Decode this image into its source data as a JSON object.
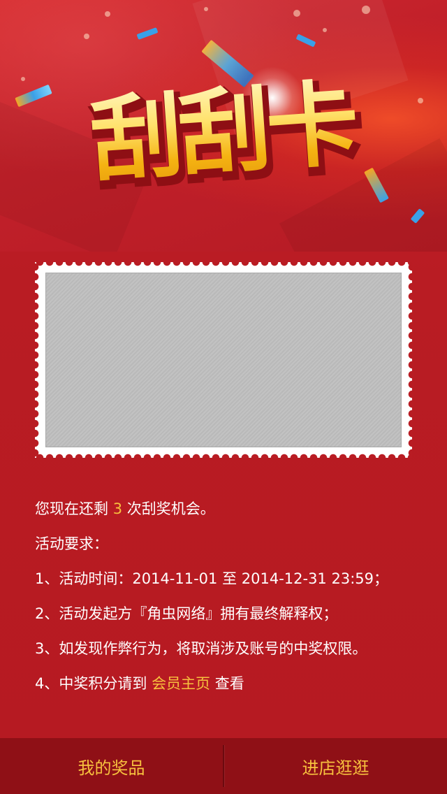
{
  "banner": {
    "title": "刮刮卡"
  },
  "info": {
    "remaining_prefix": "您现在还剩",
    "remaining_count": "3",
    "remaining_suffix": "次刮奖机会。",
    "requirements_heading": "活动要求：",
    "rule_1": "1、活动时间：2014-11-01 至 2014-12-31 23:59；",
    "rule_2": "2、活动发起方『角虫网络』拥有最终解释权；",
    "rule_3": "3、如发现作弊行为，将取消涉及账号的中奖权限。",
    "rule_4_prefix": "4、中奖积分请到",
    "rule_4_link": "会员主页",
    "rule_4_suffix": "查看"
  },
  "bottom_bar": {
    "my_prizes_label": "我的奖品",
    "visit_store_label": "进店逛逛"
  },
  "colors": {
    "background": "#b91c23",
    "accent": "#f7c13e",
    "bottom_bar": "#8f1016",
    "scratch_gray": "#c0c0c0"
  }
}
